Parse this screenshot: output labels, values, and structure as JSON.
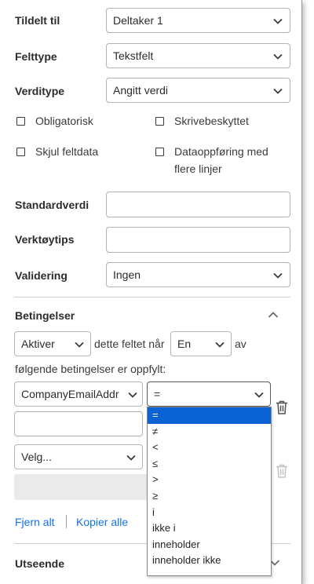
{
  "fields": {
    "assigned_label": "Tildelt til",
    "assigned_value": "Deltaker 1",
    "fieldtype_label": "Felttype",
    "fieldtype_value": "Tekstfelt",
    "valuetype_label": "Verditype",
    "valuetype_value": "Angitt verdi",
    "required_label": "Obligatorisk",
    "readonly_label": "Skrivebeskyttet",
    "hide_label": "Skjul feltdata",
    "multiline_label_1": "Dataoppføring med",
    "multiline_label_2": "flere linjer",
    "default_label": "Standardverdi",
    "default_value": "",
    "tooltip_label": "Verktøytips",
    "tooltip_value": "",
    "validation_label": "Validering",
    "validation_value": "Ingen"
  },
  "conditions": {
    "header": "Betingelser",
    "action_value": "Aktiver",
    "text_field_when": "dette feltet når",
    "match_value": "En",
    "text_of": "av",
    "text_following": "følgende betingelser er oppfylt:",
    "field1_value": "CompanyEmailAddr",
    "operator_value": "=",
    "field2_value": "Velg...",
    "remove_all": "Fjern alt",
    "copy_all": "Kopier alle"
  },
  "appearance": {
    "header": "Utseende"
  },
  "operator_options": [
    "=",
    "≠",
    "<",
    "≤",
    ">",
    "≥",
    "i",
    "ikke i",
    "inneholder",
    "inneholder ikke"
  ],
  "colors": {
    "accent": "#1473e6",
    "selected": "#0a62d4"
  }
}
